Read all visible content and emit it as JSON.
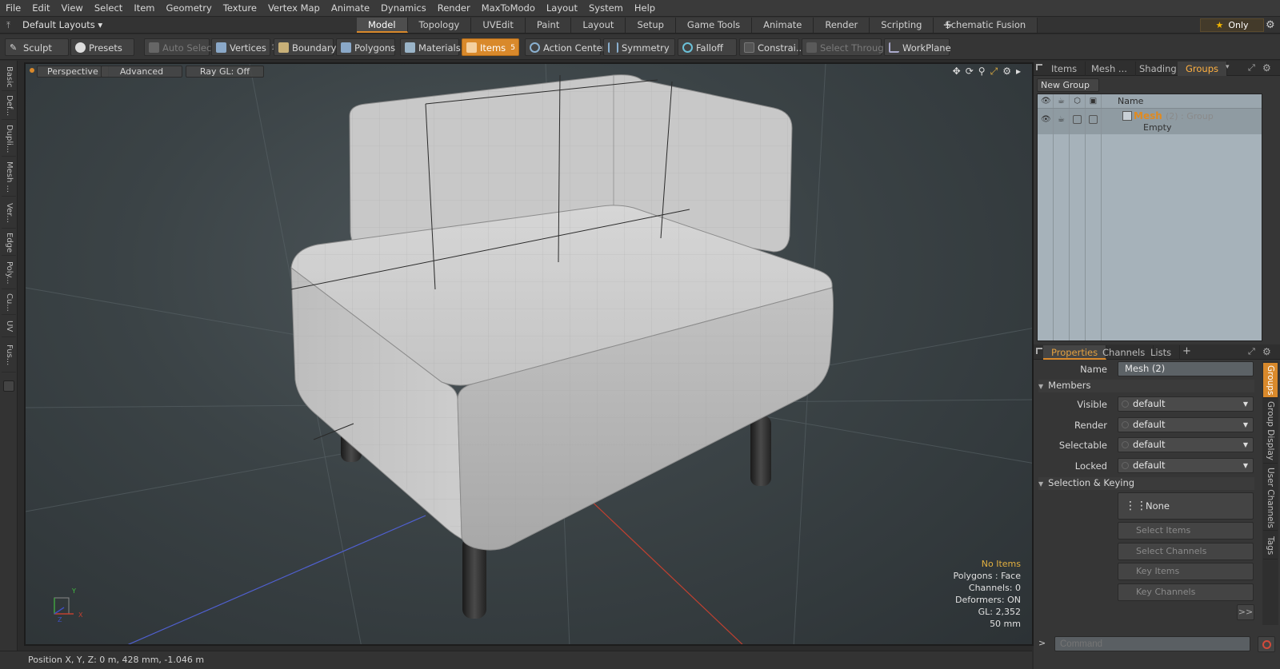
{
  "menu": [
    "File",
    "Edit",
    "View",
    "Select",
    "Item",
    "Geometry",
    "Texture",
    "Vertex Map",
    "Animate",
    "Dynamics",
    "Render",
    "MaxToModo",
    "Layout",
    "System",
    "Help"
  ],
  "layout_select": "Default Layouts ▾",
  "tabs": [
    "Model",
    "Topology",
    "UVEdit",
    "Paint",
    "Layout",
    "Setup",
    "Game Tools",
    "Animate",
    "Render",
    "Scripting",
    "Schematic Fusion"
  ],
  "active_tab": "Model",
  "only_label": "Only",
  "toolbar": {
    "sculpt": "Sculpt",
    "presets": "Presets",
    "auto_select": "Auto Select",
    "vertices": "Vertices",
    "vertices_count": "1",
    "boundary": "Boundary",
    "polygons": "Polygons",
    "materials": "Materials",
    "items": "Items",
    "items_count": "5",
    "action_center": "Action Center",
    "symmetry": "Symmetry",
    "falloff": "Falloff",
    "constraints": "Constrai...",
    "select_through": "Select Through",
    "workplane": "WorkPlane"
  },
  "left_tabs": [
    "Basic",
    "Def...",
    "Dupli...",
    "Mesh ...",
    "Ver...",
    "Edge",
    "Poly...",
    "Cu...",
    "UV",
    "Fus..."
  ],
  "viewport": {
    "view_mode": "Perspective",
    "shading": "Advanced",
    "raygl": "Ray GL: Off",
    "info": {
      "selection": "No Items",
      "polygons": "Polygons : Face",
      "channels": "Channels: 0",
      "deformers": "Deformers: ON",
      "gl": "GL: 2,352",
      "scale": "50 mm"
    },
    "axis_y": "Y",
    "axis_x": "X",
    "axis_z": "Z"
  },
  "status": "Position X, Y, Z:  0 m, 428 mm, -1.046 m",
  "right_panel": {
    "top_tabs": [
      "Items",
      "Mesh ...",
      "Shading",
      "Groups"
    ],
    "active_top_tab": "Groups",
    "new_group": "New Group",
    "name_col": "Name",
    "group": {
      "name": "Mesh",
      "count": "(2)",
      "kind": ": Group",
      "sub": "Empty"
    },
    "bottom_tabs": [
      "Properties",
      "Channels",
      "Lists"
    ],
    "properties": {
      "name_label": "Name",
      "name_value": "Mesh (2)",
      "members_section": "Members",
      "visible_label": "Visible",
      "visible_value": "default",
      "render_label": "Render",
      "render_value": "default",
      "selectable_label": "Selectable",
      "selectable_value": "default",
      "locked_label": "Locked",
      "locked_value": "default",
      "selkey_section": "Selection & Keying",
      "none_label": "None",
      "select_items": "Select Items",
      "select_channels": "Select Channels",
      "key_items": "Key Items",
      "key_channels": "Key Channels",
      "more": ">>"
    },
    "side_tabs": [
      "Groups",
      "Group Display",
      "User Channels",
      "Tags"
    ],
    "command_placeholder": "Command"
  },
  "colors": {
    "accent": "#d9892b",
    "group_name": "#e08a20",
    "warn": "#e3b040"
  }
}
